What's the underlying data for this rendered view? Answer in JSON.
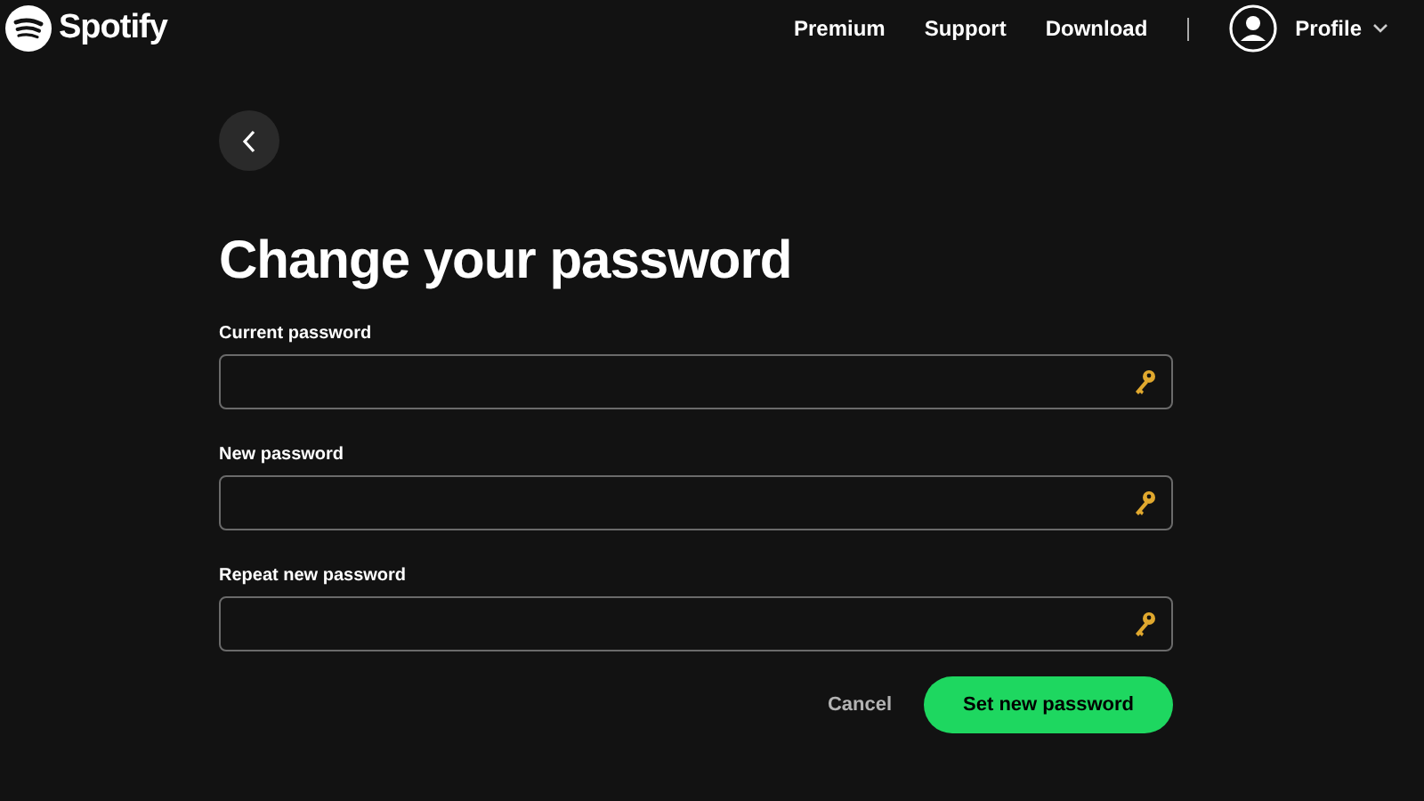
{
  "header": {
    "logo": "Spotify",
    "nav": [
      "Premium",
      "Support",
      "Download"
    ],
    "profile": "Profile"
  },
  "title": "Change your password",
  "fields": [
    {
      "label": "Current password"
    },
    {
      "label": "New password"
    },
    {
      "label": "Repeat new password"
    }
  ],
  "actions": {
    "cancel": "Cancel",
    "submit": "Set new password"
  }
}
